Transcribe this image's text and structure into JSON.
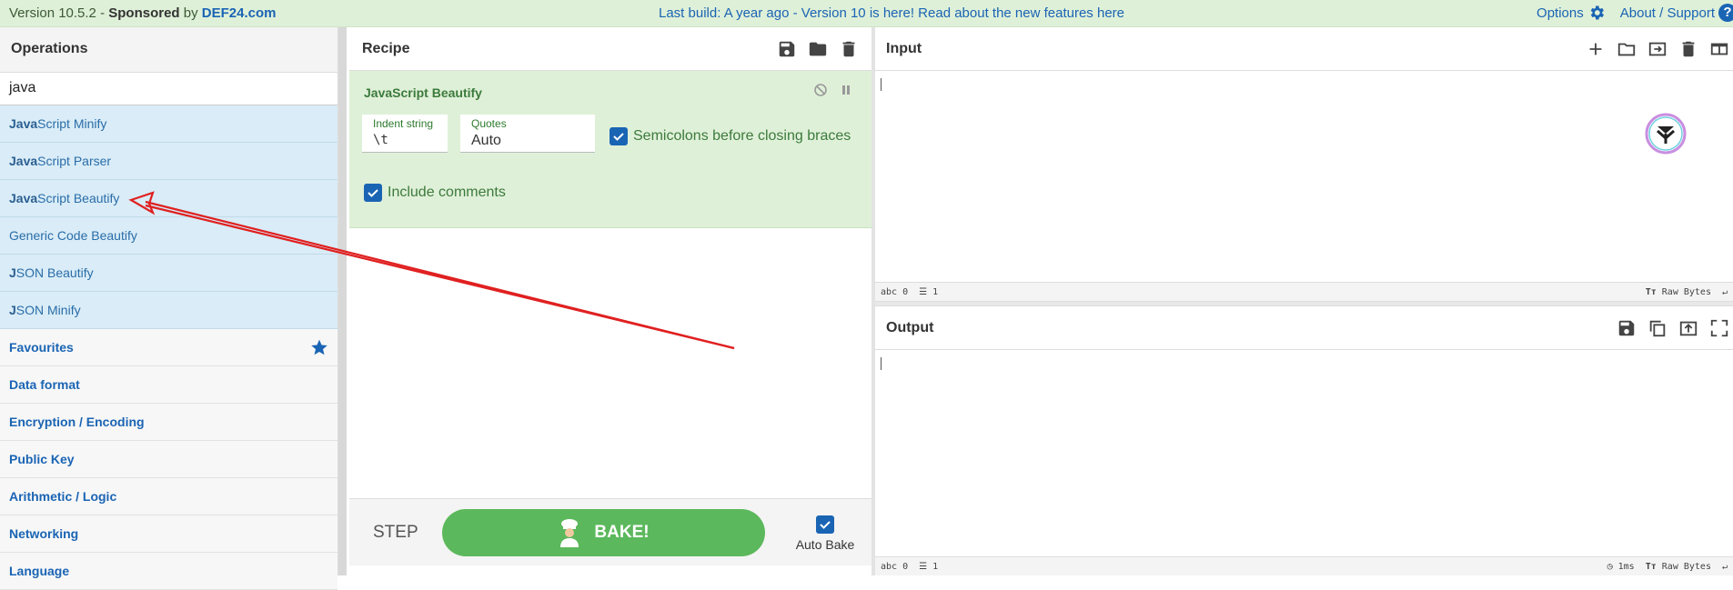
{
  "banner": {
    "version": "Version 10.5.2",
    "sponsored": "Sponsored",
    "by": "by",
    "sponsor": "DEF24.com",
    "notice": "Last build: A year ago - Version 10 is here! Read about the new features here",
    "options": "Options",
    "about": "About / Support",
    "help": "?"
  },
  "operations": {
    "title": "Operations",
    "search_value": "java",
    "results": [
      {
        "bold": "Java",
        "rest": "Script Minify"
      },
      {
        "bold": "Java",
        "rest": "Script Parser"
      },
      {
        "bold": "Java",
        "rest": "Script Beautify"
      },
      {
        "bold": "",
        "rest": "Generic Code Beautify"
      },
      {
        "bold": "J",
        "rest": "SON Beautify"
      },
      {
        "bold": "J",
        "rest": "SON Minify"
      }
    ],
    "categories": [
      "Favourites",
      "Data format",
      "Encryption / Encoding",
      "Public Key",
      "Arithmetic / Logic",
      "Networking",
      "Language"
    ]
  },
  "recipe": {
    "title": "Recipe",
    "op_name": "JavaScript Beautify",
    "indent_label": "Indent string",
    "indent_value": "\\t",
    "quotes_label": "Quotes",
    "quotes_value": "Auto",
    "semicolons_label": "Semicolons before closing braces",
    "comments_label": "Include comments",
    "step_label": "STEP",
    "bake_label": "BAKE!",
    "autobake_label": "Auto Bake"
  },
  "input": {
    "title": "Input",
    "chars": "0",
    "lines": "1",
    "format": "Raw Bytes"
  },
  "output": {
    "title": "Output",
    "chars": "0",
    "lines": "1",
    "time": "1ms",
    "format": "Raw Bytes"
  },
  "colors": {
    "accent": "#1a64b4",
    "banner_bg": "#dff0d8",
    "result_bg": "#d9ecf7",
    "bake_green": "#5cb85c",
    "arrow_red": "#e02020"
  }
}
